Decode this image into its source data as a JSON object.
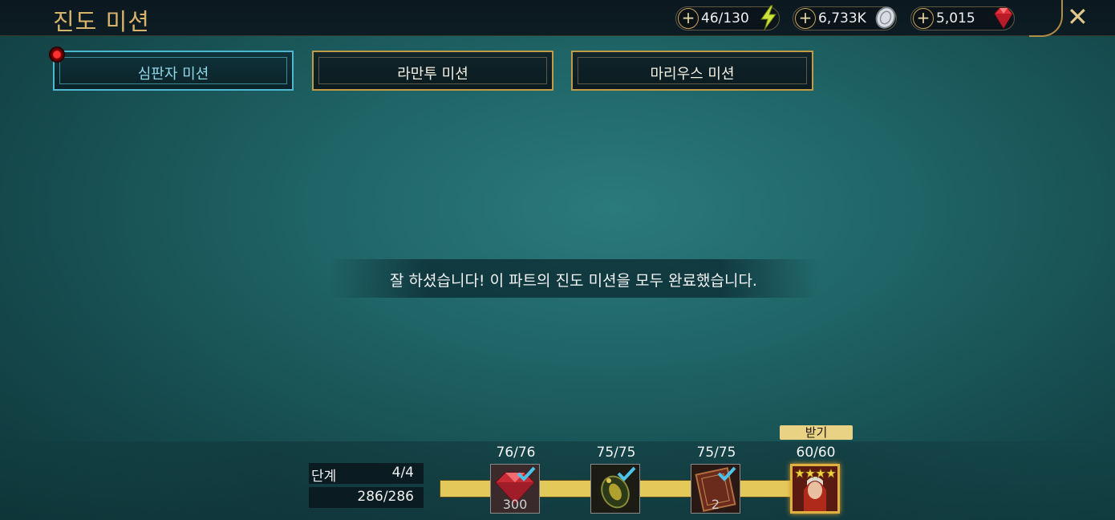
{
  "header": {
    "title": "진도 미션",
    "resources": [
      {
        "value": "46/130",
        "icon": "energy-bolt-icon",
        "color": "#c8e03a"
      },
      {
        "value": "6,733K",
        "icon": "silver-coin-icon",
        "color": "#c8ccd0"
      },
      {
        "value": "5,015",
        "icon": "ruby-gem-icon",
        "color": "#e0303a"
      }
    ],
    "close_icon": "close-icon"
  },
  "tabs": [
    {
      "label": "심판자 미션",
      "active": true,
      "notification": true
    },
    {
      "label": "라만투 미션",
      "active": false
    },
    {
      "label": "마리우스 미션",
      "active": false
    }
  ],
  "message": "잘 하셨습니다! 이 파트의 진도 미션을 모두 완료했습니다.",
  "progress": {
    "stage_label": "단계",
    "stage_value": "4/4",
    "points_value": "286/286",
    "claim_label": "받기",
    "milestones": [
      {
        "count": "76/76",
        "reward": "ruby-gem-reward-icon",
        "quantity": "300",
        "completed": true
      },
      {
        "count": "75/75",
        "reward": "artifact-helmet-reward-icon",
        "quantity": "",
        "completed": true
      },
      {
        "count": "75/75",
        "reward": "book-reward-icon",
        "quantity": "2",
        "completed": true
      },
      {
        "count": "60/60",
        "reward": "champion-portrait-icon",
        "quantity": "",
        "completed": false,
        "stars": 4
      }
    ]
  },
  "colors": {
    "accent_gold": "#c09a45",
    "active_tab": "#4fb7cf",
    "track": "#e2c95a"
  }
}
